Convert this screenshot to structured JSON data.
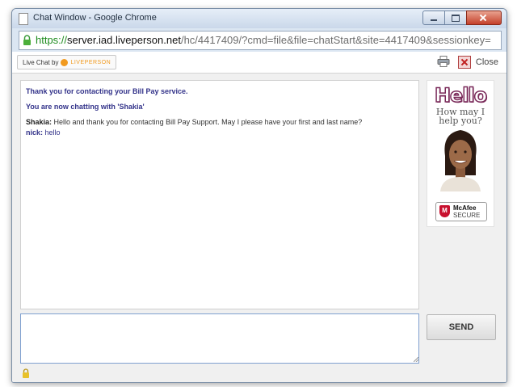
{
  "window": {
    "title": "Chat Window - Google Chrome",
    "url": {
      "scheme": "https://",
      "host": "server.iad.liveperson.net",
      "path": "/hc/4417409/?cmd=file&file=chatStart&site=4417409&sessionkey="
    }
  },
  "toolbar": {
    "brand_prefix": "Live Chat by",
    "brand_name": "LIVEPERSON",
    "print_icon": "printer-icon",
    "close_label": "Close"
  },
  "transcript": {
    "system_messages": [
      "Thank you for contacting your Bill Pay service.",
      "You are now chatting with 'Shakia'"
    ],
    "messages": [
      {
        "sender": "Shakia:",
        "text": " Hello and thank you for contacting Bill Pay Support.  May I please have your first and last name?"
      },
      {
        "sender": "nick:",
        "text": " hello"
      }
    ]
  },
  "ad": {
    "headline": "Hello",
    "tagline": "How may I help you?",
    "badge_name": "McAfee",
    "badge_sub": "SECURE"
  },
  "composer": {
    "value": "",
    "send_label": "SEND"
  },
  "colors": {
    "system_text": "#33338a",
    "url_scheme": "#1e8c1e",
    "liveperson_orange": "#f19a1f",
    "hello_outline": "#7a2a5a"
  }
}
